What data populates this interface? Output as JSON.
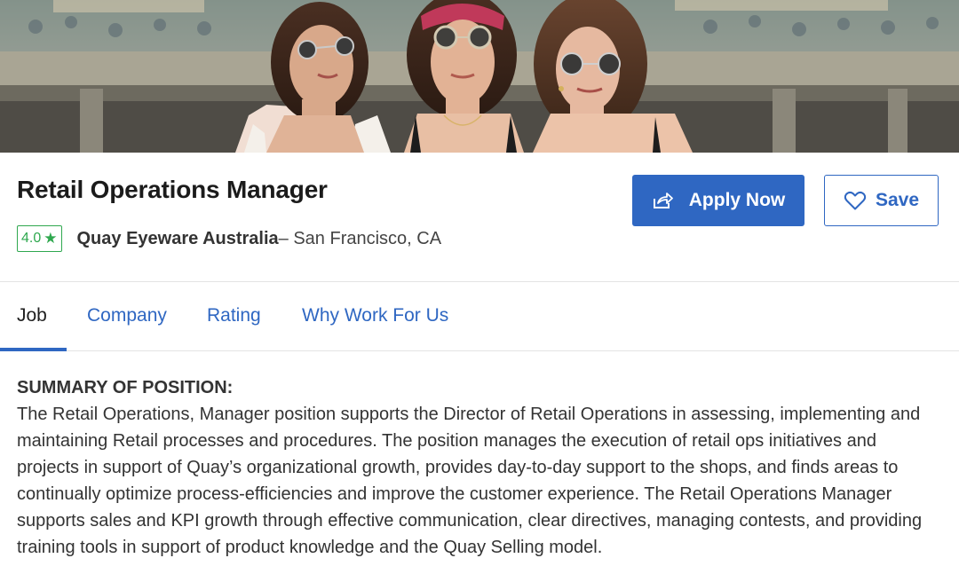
{
  "job": {
    "title": "Retail Operations Manager",
    "rating": "4.0",
    "rating_star": "★",
    "company": "Quay Eyeware Australia",
    "location": "– San Francisco, CA"
  },
  "actions": {
    "apply_label": "Apply Now",
    "save_label": "Save"
  },
  "tabs": [
    {
      "label": "Job",
      "active": true
    },
    {
      "label": "Company",
      "active": false
    },
    {
      "label": "Rating",
      "active": false
    },
    {
      "label": "Why Work For Us",
      "active": false
    }
  ],
  "summary": {
    "heading": "SUMMARY OF POSITION:",
    "body": "The Retail Operations, Manager position supports the Director of Retail Operations in assessing, implementing and maintaining Retail processes and procedures. The position manages the execution of retail ops initiatives and projects in support of Quay’s organizational growth, provides day-to-day support to the shops, and finds areas to continually optimize process-efficiencies and improve the customer experience. The Retail Operations Manager supports sales and KPI growth through effective communication, clear directives, managing contests, and providing training tools in support of product knowledge and the Quay Selling model."
  },
  "colors": {
    "accent": "#2f67c2",
    "rating_green": "#2fa84f"
  },
  "icons": {
    "apply": "share-arrow-icon",
    "save": "heart-icon",
    "rating": "star-icon"
  }
}
